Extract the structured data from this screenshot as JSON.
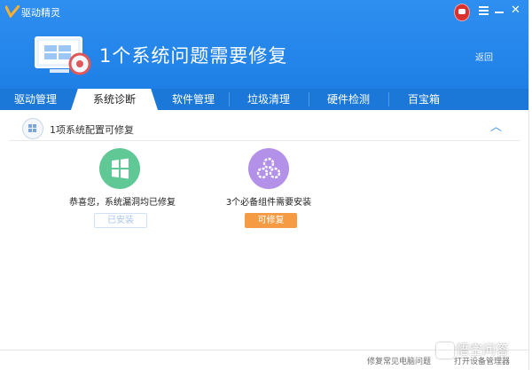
{
  "window": {
    "title": "驱动精灵"
  },
  "header": {
    "headline": "1个系统问题需要修复",
    "back_label": "返回"
  },
  "tabs": [
    {
      "label": "驱动管理"
    },
    {
      "label": "系统诊断"
    },
    {
      "label": "软件管理"
    },
    {
      "label": "垃圾清理"
    },
    {
      "label": "硬件检测"
    },
    {
      "label": "百宝箱"
    }
  ],
  "active_tab": "系统诊断",
  "section": {
    "title": "1项系统配置可修复"
  },
  "cards": [
    {
      "text": "恭喜您，系统漏洞均已修复",
      "button": "已安装",
      "icon": "windows-shield-icon",
      "color": "#5fc894"
    },
    {
      "text": "3个必备组件需要安装",
      "button": "可修复",
      "icon": "gears-icon",
      "color": "#b491e8"
    }
  ],
  "footer": {
    "link1": "修复常见电脑问题",
    "link2": "打开设备管理器"
  },
  "watermark": {
    "text": "悟空问答"
  },
  "colors": {
    "header": "#2f8ff0",
    "tabbar": "#1c78d8",
    "fix_button": "#f49b43",
    "accent": "#3a8ee6"
  }
}
